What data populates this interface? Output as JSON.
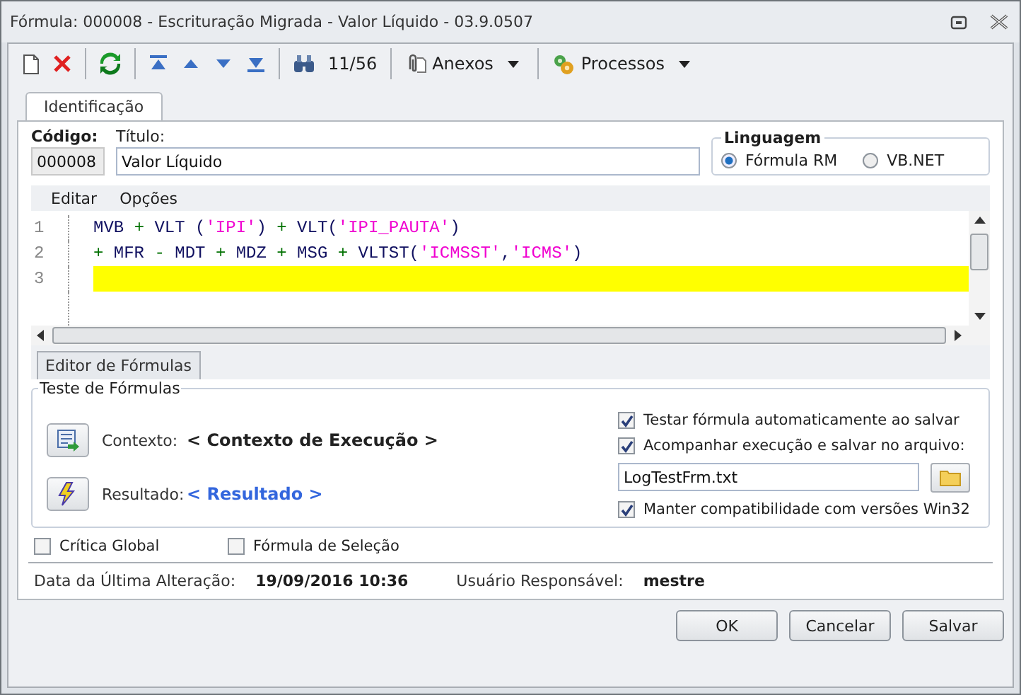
{
  "window": {
    "title": "Fórmula: 000008 - Escrituração Migrada - Valor Líquido - 03.9.0507"
  },
  "toolbar": {
    "counter": "11/56",
    "menus": [
      {
        "kind": "attachment",
        "label": "Anexos"
      },
      {
        "kind": "process",
        "label": "Processos"
      }
    ]
  },
  "tabs": [
    {
      "label": "Identificação",
      "selected": true
    }
  ],
  "code_field": {
    "label": "Código:",
    "value": "000008"
  },
  "title_field": {
    "label": "Título:",
    "value": "Valor Líquido"
  },
  "language": {
    "title": "Linguagem",
    "options": [
      {
        "label": "Fórmula RM",
        "selected": true
      },
      {
        "label": "VB.NET",
        "selected": false
      }
    ]
  },
  "editor": {
    "menu": [
      "Editar",
      "Opções"
    ],
    "lines": [
      {
        "number": "1",
        "highlighted": false,
        "tokens": [
          {
            "kind": "ident",
            "text": "MVB "
          },
          {
            "kind": "op",
            "text": "+"
          },
          {
            "kind": "ident",
            "text": " VLT ("
          },
          {
            "kind": "str",
            "text": "'IPI'"
          },
          {
            "kind": "ident",
            "text": ") "
          },
          {
            "kind": "op",
            "text": "+"
          },
          {
            "kind": "ident",
            "text": " VLT("
          },
          {
            "kind": "str",
            "text": "'IPI_PAUTA'"
          },
          {
            "kind": "ident",
            "text": ")"
          }
        ]
      },
      {
        "number": "2",
        "highlighted": false,
        "tokens": [
          {
            "kind": "op",
            "text": "+"
          },
          {
            "kind": "ident",
            "text": " MFR "
          },
          {
            "kind": "op",
            "text": "-"
          },
          {
            "kind": "ident",
            "text": " MDT "
          },
          {
            "kind": "op",
            "text": "+"
          },
          {
            "kind": "ident",
            "text": " MDZ "
          },
          {
            "kind": "op",
            "text": "+"
          },
          {
            "kind": "ident",
            "text": " MSG "
          },
          {
            "kind": "op",
            "text": "+"
          },
          {
            "kind": "ident",
            "text": " VLTST("
          },
          {
            "kind": "str",
            "text": "'ICMSST'"
          },
          {
            "kind": "ident",
            "text": ","
          },
          {
            "kind": "str",
            "text": "'ICMS'"
          },
          {
            "kind": "ident",
            "text": ")"
          }
        ]
      },
      {
        "number": "3",
        "highlighted": true
      }
    ],
    "tabs": [
      {
        "label": "Editor de Fórmulas",
        "selected": true
      }
    ]
  },
  "test": {
    "title": "Teste de Fórmulas",
    "context": {
      "label": "Contexto:",
      "value": "< Contexto de Execução >"
    },
    "result": {
      "label": "Resultado:",
      "value": "< Resultado >"
    },
    "options": [
      {
        "kind": "checkbox",
        "label": "Testar fórmula automaticamente ao salvar",
        "checked": true
      },
      {
        "kind": "checkbox",
        "label": "Acompanhar execução e salvar no arquivo:",
        "checked": true
      },
      {
        "kind": "file",
        "value": "LogTestFrm.txt"
      },
      {
        "kind": "checkbox",
        "label": "Manter compatibilidade com versões Win32",
        "checked": true
      }
    ]
  },
  "flags": [
    {
      "label": "Crítica Global",
      "checked": false
    },
    {
      "label": "Fórmula de Seleção",
      "checked": false
    }
  ],
  "info": [
    {
      "label": "Data da Última Alteração:",
      "value": "19/09/2016 10:36"
    },
    {
      "label": "Usuário Responsável:",
      "value": "mestre"
    }
  ],
  "buttons": [
    "OK",
    "Cancelar",
    "Salvar"
  ]
}
